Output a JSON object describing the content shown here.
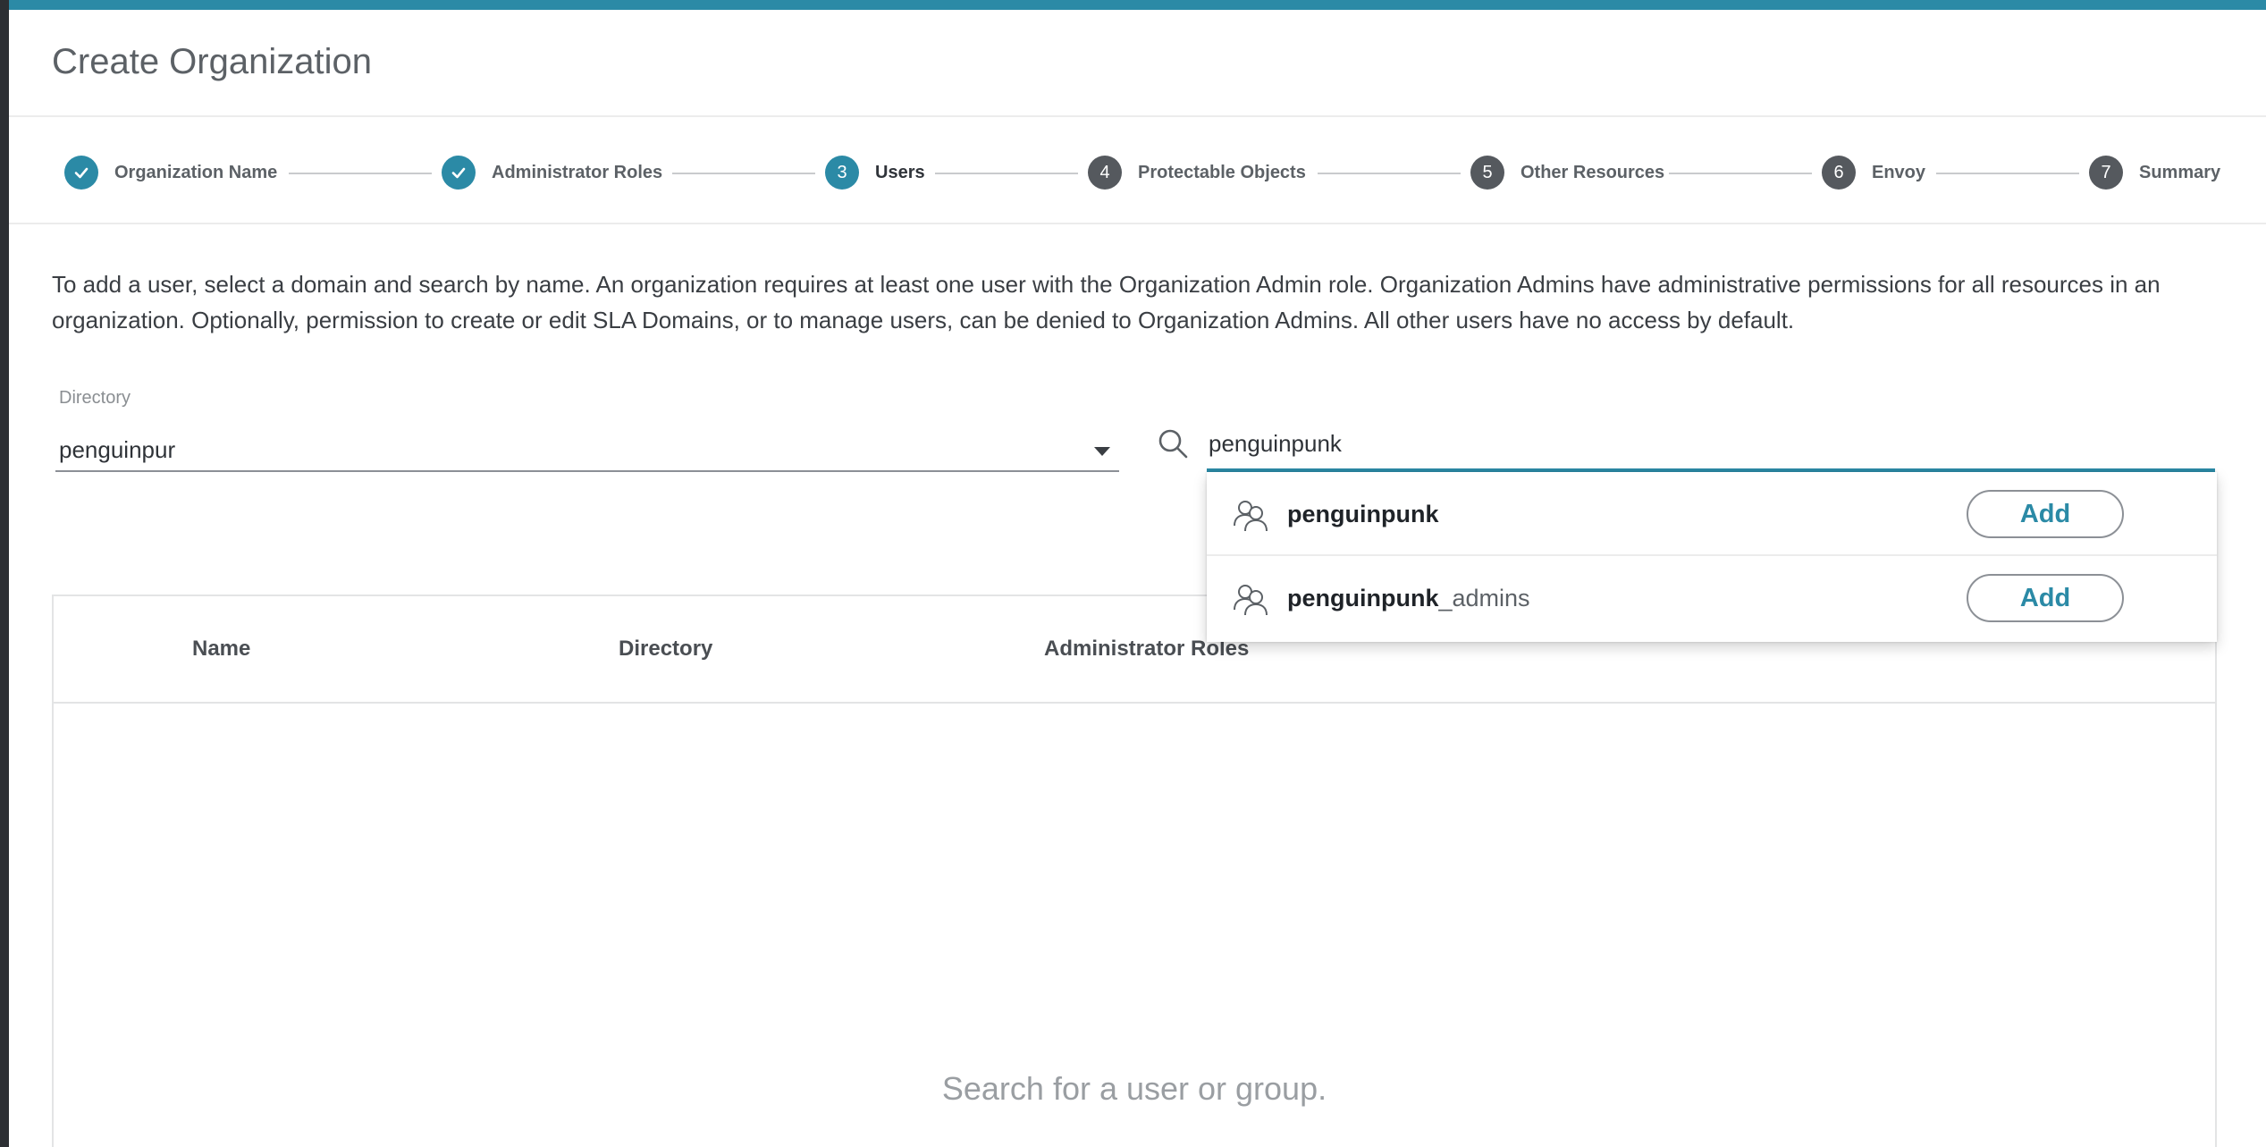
{
  "modal": {
    "title": "Create Organization"
  },
  "stepper": {
    "steps": [
      {
        "number": "1",
        "label": "Organization Name",
        "state": "done"
      },
      {
        "number": "2",
        "label": "Administrator Roles",
        "state": "done"
      },
      {
        "number": "3",
        "label": "Users",
        "state": "active"
      },
      {
        "number": "4",
        "label": "Protectable Objects",
        "state": "todo"
      },
      {
        "number": "5",
        "label": "Other Resources",
        "state": "todo"
      },
      {
        "number": "6",
        "label": "Envoy",
        "state": "todo"
      },
      {
        "number": "7",
        "label": "Summary",
        "state": "todo"
      }
    ]
  },
  "description": "To add a user, select a domain and search by name. An organization requires at least one user with the Organization Admin role. Organization Admins have administrative permissions for all resources in an organization. Optionally, permission to create or edit SLA Domains, or to manage users, can be denied to Organization Admins. All other users have no access by default.",
  "directory": {
    "label": "Directory",
    "value": "penguinpur"
  },
  "search": {
    "value": "penguinpunk"
  },
  "results": [
    {
      "match": "penguinpunk",
      "rest": "",
      "add_label": "Add"
    },
    {
      "match": "penguinpunk",
      "rest": "_admins",
      "add_label": "Add"
    }
  ],
  "table": {
    "columns": [
      "Name",
      "Directory",
      "Administrator Roles"
    ],
    "empty_text": "Search for a user or group."
  },
  "colors": {
    "accent": "#2b8aa6",
    "pending_step": "#55595e"
  }
}
